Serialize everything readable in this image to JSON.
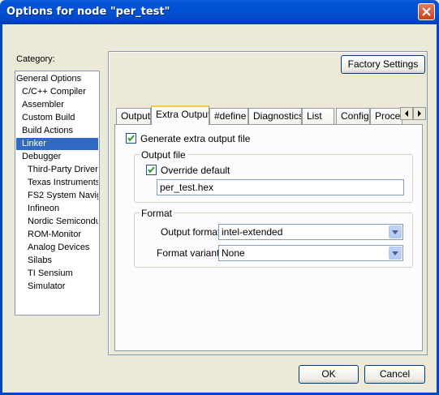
{
  "window": {
    "title": "Options for node \"per_test\""
  },
  "category": {
    "label": "Category:",
    "items": [
      {
        "label": "General Options"
      },
      {
        "label": "C/C++ Compiler"
      },
      {
        "label": "Assembler"
      },
      {
        "label": "Custom Build"
      },
      {
        "label": "Build Actions"
      },
      {
        "label": "Linker"
      },
      {
        "label": "Debugger"
      },
      {
        "label": "Third-Party Driver"
      },
      {
        "label": "Texas Instruments"
      },
      {
        "label": "FS2 System Navig"
      },
      {
        "label": "Infineon"
      },
      {
        "label": "Nordic Semiconduc"
      },
      {
        "label": "ROM-Monitor"
      },
      {
        "label": "Analog Devices"
      },
      {
        "label": "Silabs"
      },
      {
        "label": "TI Sensium"
      },
      {
        "label": "Simulator"
      }
    ],
    "selected": "Linker"
  },
  "factory_settings_label": "Factory Settings",
  "tabs": [
    {
      "label": "Output"
    },
    {
      "label": "Extra Output"
    },
    {
      "label": "#define"
    },
    {
      "label": "Diagnostics"
    },
    {
      "label": "List"
    },
    {
      "label": "Config"
    },
    {
      "label": "Proce"
    }
  ],
  "active_tab": "Extra Output",
  "extra_output": {
    "generate_label": "Generate extra output file",
    "generate_checked": true,
    "output_file_group": "Output file",
    "override_label": "Override default",
    "override_checked": true,
    "filename": "per_test.hex",
    "format_group": "Format",
    "output_format_label": "Output format:",
    "output_format_value": "intel-extended",
    "format_variant_label": "Format variant:",
    "format_variant_value": "None"
  },
  "buttons": {
    "ok": "OK",
    "cancel": "Cancel"
  },
  "colors": {
    "titlebar": "#0051d3",
    "selection": "#316ac5",
    "face": "#ece9d8"
  }
}
